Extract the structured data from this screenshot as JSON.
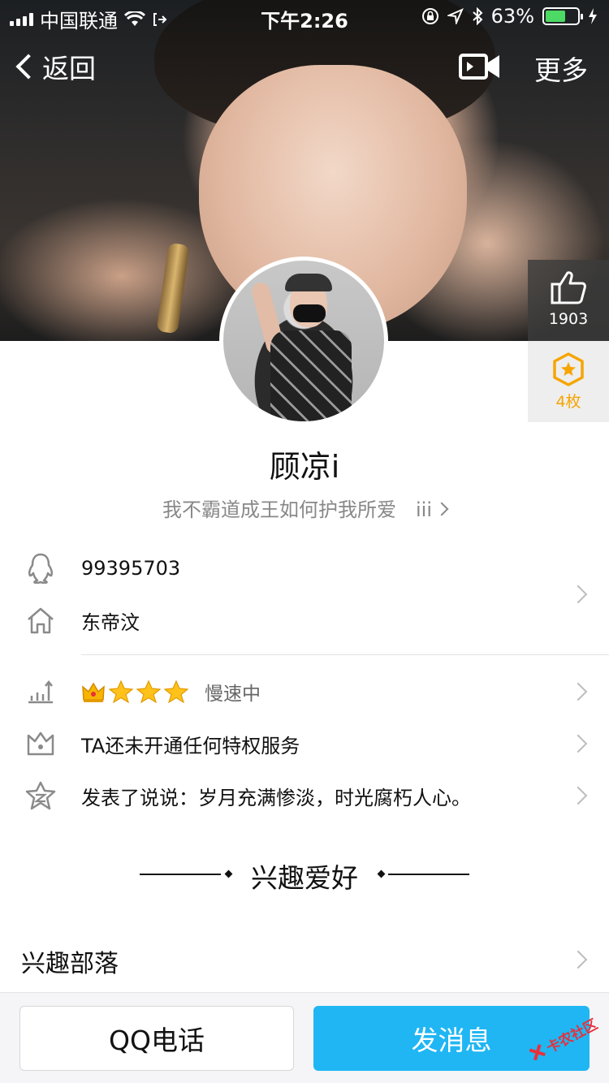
{
  "status_bar": {
    "carrier": "中国联通",
    "time": "下午2:26",
    "battery": "63%",
    "battery_level": 0.63
  },
  "nav": {
    "back_label": "返回",
    "more_label": "更多"
  },
  "profile": {
    "nickname": "顾凉i",
    "signature": "我不霸道成王如何护我所爱　iii",
    "likes": "1903",
    "badges": "4枚"
  },
  "info": {
    "qq_number": "99395703",
    "location": "东帝汶",
    "level_status": "慢速中",
    "privilege": "TA还未开通任何特权服务",
    "post": "发表了说说：岁月充满惨淡，时光腐朽人心。"
  },
  "section": {
    "hobbies_title": "兴趣爱好",
    "tribe_label": "兴趣部落"
  },
  "bottom": {
    "call_label": "QQ电话",
    "message_label": "发消息"
  },
  "watermark": "卡农社区",
  "colors": {
    "accent": "#1fb6f3",
    "badge": "#f6a500",
    "battery": "#4cd964"
  }
}
